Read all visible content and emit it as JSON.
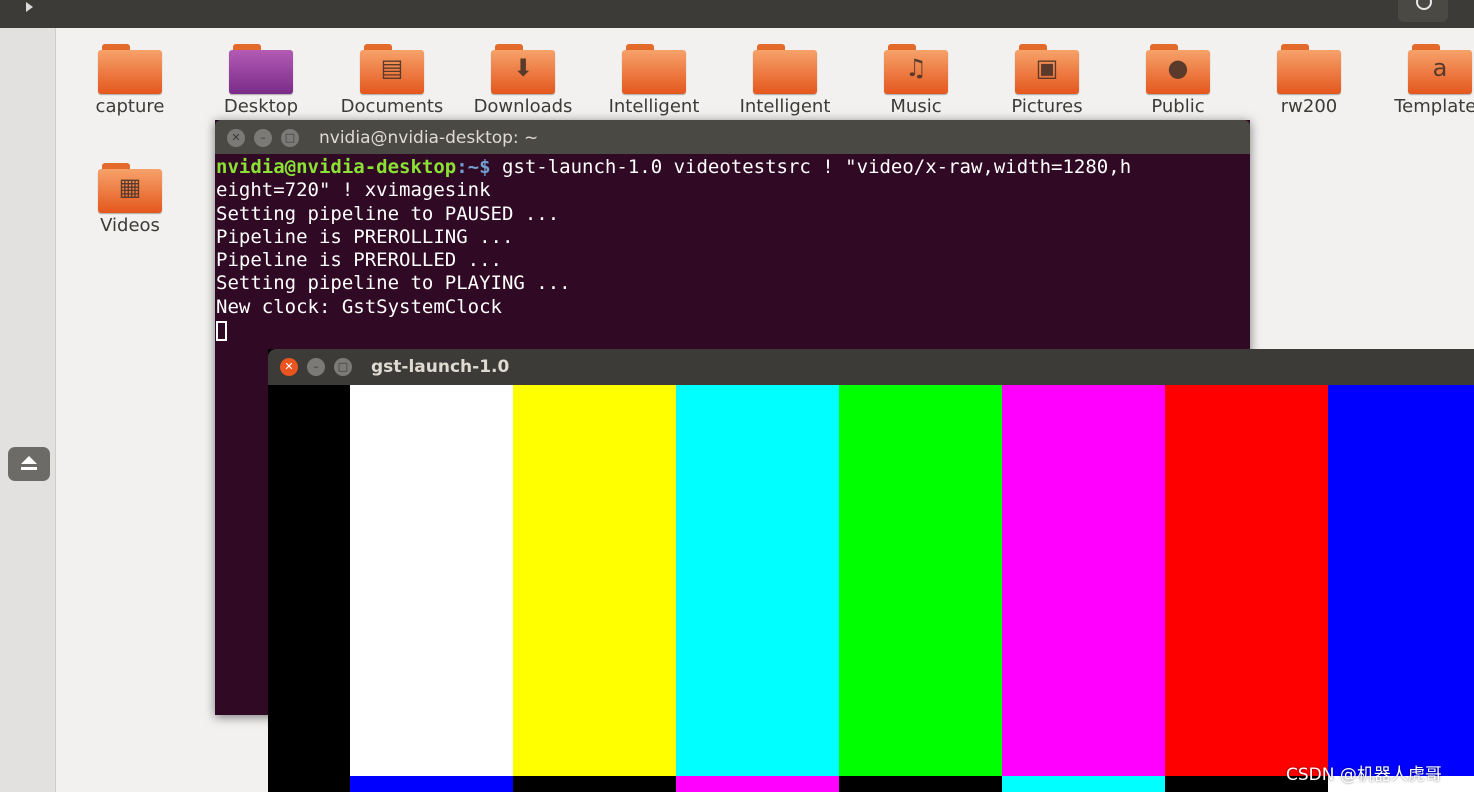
{
  "file_manager": {
    "folders_row1": [
      {
        "label": "capture",
        "icon": "folder-icon"
      },
      {
        "label": "Desktop",
        "icon": "desktop-folder-icon"
      },
      {
        "label": "Documents",
        "icon": "documents-folder-icon"
      },
      {
        "label": "Downloads",
        "icon": "downloads-folder-icon"
      },
      {
        "label": "Intelligent",
        "icon": "folder-icon"
      },
      {
        "label": "Intelligent",
        "icon": "folder-icon"
      },
      {
        "label": "Music",
        "icon": "music-folder-icon"
      },
      {
        "label": "Pictures",
        "icon": "pictures-folder-icon"
      },
      {
        "label": "Public",
        "icon": "public-folder-icon"
      },
      {
        "label": "rw200",
        "icon": "folder-icon"
      },
      {
        "label": "Templates",
        "icon": "templates-folder-icon"
      }
    ],
    "folders_row2": [
      {
        "label": "Videos",
        "icon": "videos-folder-icon"
      }
    ]
  },
  "terminal": {
    "title": "nvidia@nvidia-desktop: ~",
    "prompt_user": "nvidia@nvidia-desktop",
    "prompt_sep": ":~$ ",
    "command_line1": "gst-launch-1.0 videotestsrc ! \"video/x-raw,width=1280,h",
    "command_line2": "eight=720\" ! xvimagesink",
    "output": [
      "Setting pipeline to PAUSED ...",
      "Pipeline is PREROLLING ...",
      "Pipeline is PREROLLED ...",
      "Setting pipeline to PLAYING ...",
      "New clock: GstSystemClock"
    ]
  },
  "video_window": {
    "title": "gst-launch-1.0",
    "bar_colors": [
      "#000000",
      "#ffffff",
      "#ffff00",
      "#00ffff",
      "#00ff00",
      "#ff00ff",
      "#ff0000",
      "#0000ff"
    ],
    "sub_colors": [
      "#000000",
      "#0000ff",
      "#000000",
      "#ff00ff",
      "#000000",
      "#00ffff",
      "#000000",
      "#ffffff"
    ]
  },
  "watermark": "CSDN @机器人虎哥",
  "colors": {
    "terminal_bg": "#300a24",
    "prompt_user": "#8ae234",
    "prompt_path": "#729fcf",
    "close_button": "#e95420",
    "folder_orange": "#e4571d"
  }
}
